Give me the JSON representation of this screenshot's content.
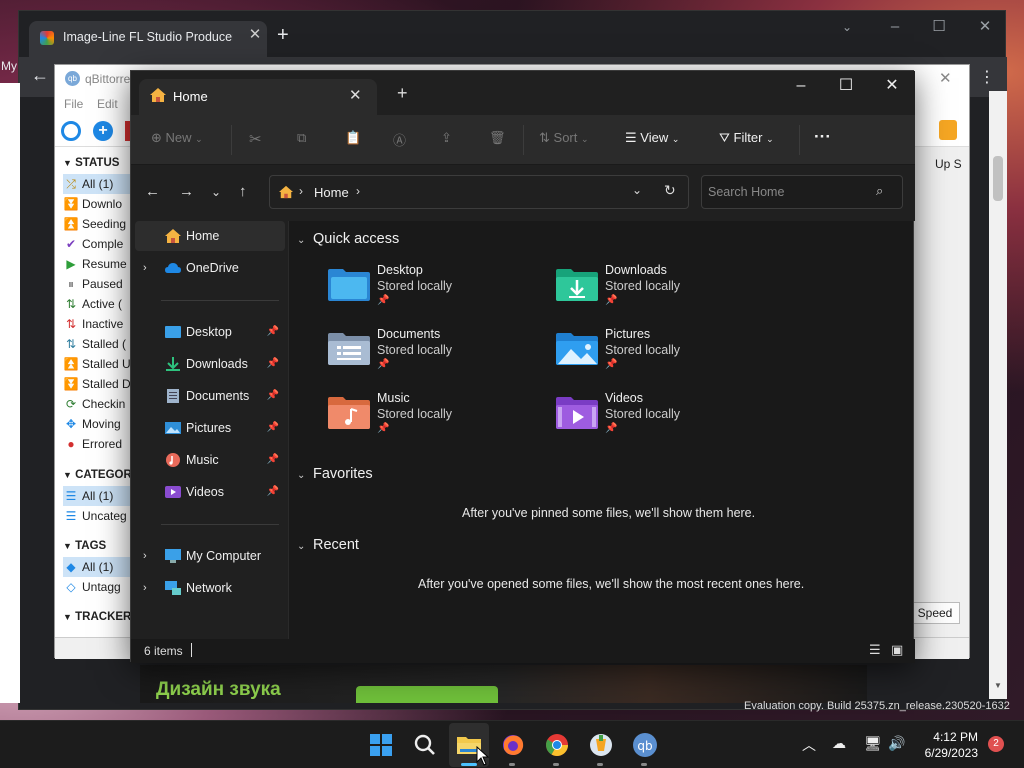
{
  "colors": {
    "accent": "#4cc2ff",
    "folder_yellow": "#f2c94c",
    "explorer_bg": "#191919",
    "taskbar_bg": "#1c1c1c",
    "qb_blue": "#1e88e5"
  },
  "chrome": {
    "tab_title": "Image-Line FL Studio Producer E",
    "left_text": "My"
  },
  "qbittorrent": {
    "title": "qBittorre",
    "menu": [
      "File",
      "Edit"
    ],
    "status_header": "STATUS",
    "status_items": [
      {
        "label": "All (1)",
        "icon": "shuffle-icon",
        "color": "#b8860b"
      },
      {
        "label": "Downlo",
        "icon": "download-arrows-icon",
        "color": "#2e7d32"
      },
      {
        "label": "Seeding",
        "icon": "upload-arrows-icon",
        "color": "#3949ab"
      },
      {
        "label": "Comple",
        "icon": "check-icon",
        "color": "#7b3fbf"
      },
      {
        "label": "Resume",
        "icon": "play-icon",
        "color": "#2e9e3a"
      },
      {
        "label": "Paused",
        "icon": "pause-icon",
        "color": "#777777"
      },
      {
        "label": "Active (",
        "icon": "active-arrows-icon",
        "color": "#2e7d32"
      },
      {
        "label": "Inactive",
        "icon": "inactive-arrows-icon",
        "color": "#d32f2f"
      },
      {
        "label": "Stalled (",
        "icon": "stalled-arrows-icon",
        "color": "#2e7d9e"
      },
      {
        "label": "Stalled U",
        "icon": "stalled-up-icon",
        "color": "#3949ab"
      },
      {
        "label": "Stalled D",
        "icon": "stalled-down-icon",
        "color": "#2e7d32"
      },
      {
        "label": "Checkin",
        "icon": "refresh-icon",
        "color": "#2e7d32"
      },
      {
        "label": "Moving",
        "icon": "moving-icon",
        "color": "#1e88e5"
      },
      {
        "label": "Errored",
        "icon": "error-icon",
        "color": "#d32f2f"
      }
    ],
    "categories_header": "CATEGOR",
    "categories_items": [
      {
        "label": "All (1)",
        "icon": "list-icon"
      },
      {
        "label": "Uncateg",
        "icon": "list-icon"
      }
    ],
    "tags_header": "TAGS",
    "tags_items": [
      {
        "label": "All (1)",
        "icon": "tag-icon"
      },
      {
        "label": "Untagg",
        "icon": "tag-icon"
      }
    ],
    "trackers_header": "TRACKER",
    "up_speed_col": "Up S",
    "speed_button": "Speed"
  },
  "explorer": {
    "tab_label": "Home",
    "toolbar": {
      "new": "New",
      "sort": "Sort",
      "view": "View",
      "filter": "Filter",
      "more": "···"
    },
    "address": "Home",
    "search_placeholder": "Search Home",
    "nav": {
      "home": "Home",
      "onedrive": "OneDrive",
      "desktop": "Desktop",
      "downloads": "Downloads",
      "documents": "Documents",
      "pictures": "Pictures",
      "music": "Music",
      "videos": "Videos",
      "my_computer": "My Computer",
      "network": "Network"
    },
    "quick_access_title": "Quick access",
    "quick_access": [
      {
        "name": "Desktop",
        "sub": "Stored locally"
      },
      {
        "name": "Downloads",
        "sub": "Stored locally"
      },
      {
        "name": "Documents",
        "sub": "Stored locally"
      },
      {
        "name": "Pictures",
        "sub": "Stored locally"
      },
      {
        "name": "Music",
        "sub": "Stored locally"
      },
      {
        "name": "Videos",
        "sub": "Stored locally"
      }
    ],
    "favorites_title": "Favorites",
    "favorites_msg": "After you've pinned some files, we'll show them here.",
    "recent_title": "Recent",
    "recent_msg": "After you've opened some files, we'll show the most recent ones here.",
    "status": "6 items"
  },
  "ad": {
    "text": "Дизайн звука",
    "eval": "Evaluation copy. Build 25375.zn_release.230520-1632"
  },
  "taskbar": {
    "time": "4:12 PM",
    "date": "6/29/2023",
    "badge": "2"
  }
}
